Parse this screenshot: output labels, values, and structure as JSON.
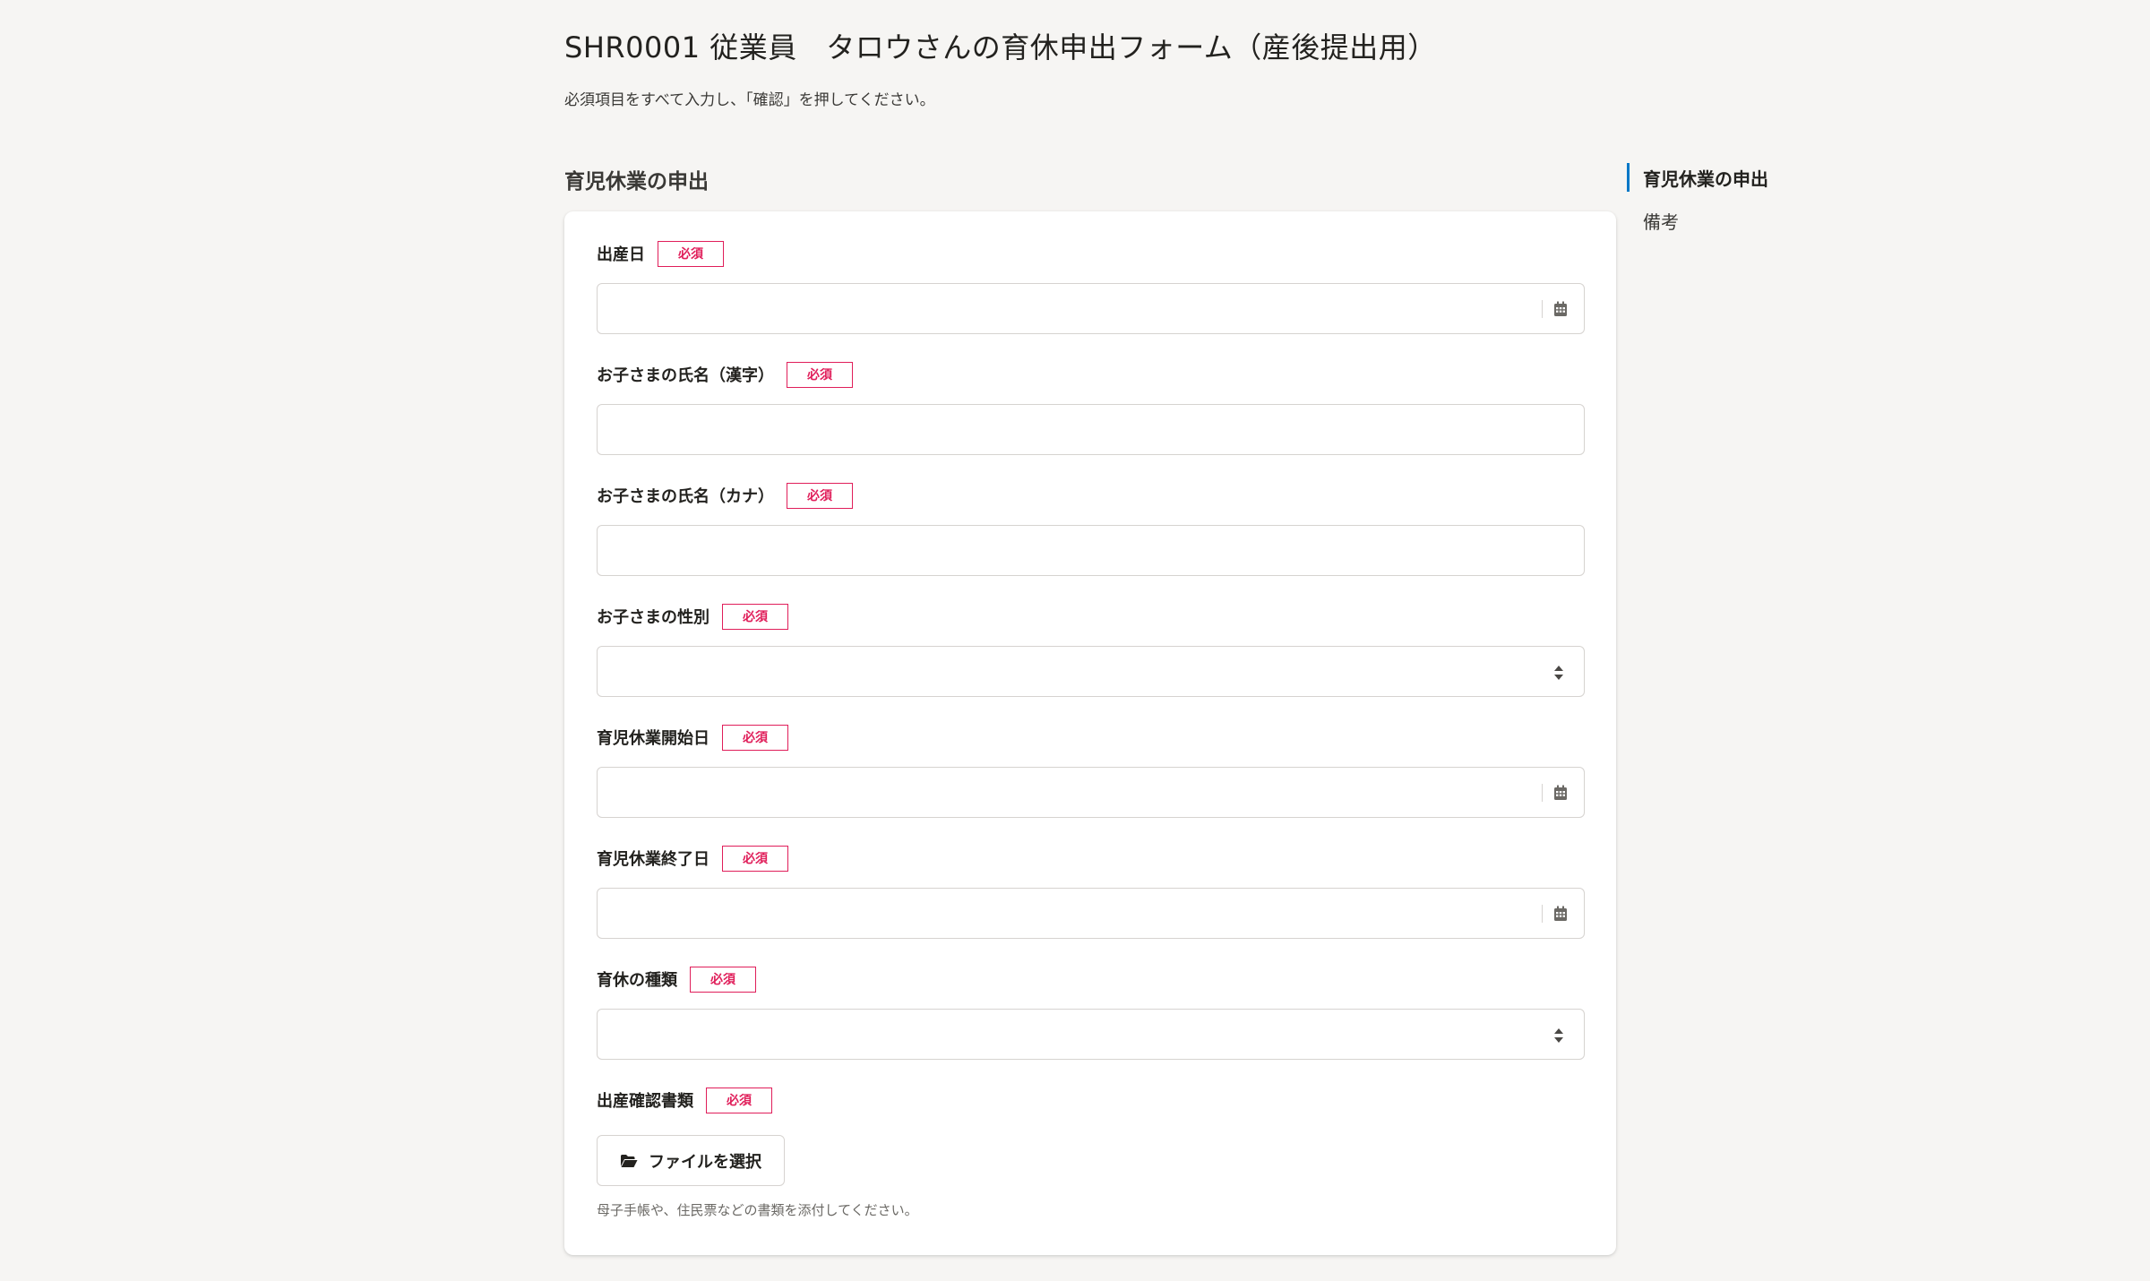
{
  "header": {
    "title": "SHR0001 従業員　タロウさんの育休申出フォーム（産後提出用）",
    "description": "必須項目をすべて入力し、「確認」を押してください。"
  },
  "section": {
    "heading": "育児休業の申出"
  },
  "required_label": "必須",
  "fields": [
    {
      "label": "出産日",
      "type": "date",
      "value": ""
    },
    {
      "label": "お子さまの氏名（漢字）",
      "type": "text",
      "value": ""
    },
    {
      "label": "お子さまの氏名（カナ）",
      "type": "text",
      "value": ""
    },
    {
      "label": "お子さまの性別",
      "type": "select",
      "value": ""
    },
    {
      "label": "育児休業開始日",
      "type": "date",
      "value": ""
    },
    {
      "label": "育児休業終了日",
      "type": "date",
      "value": ""
    },
    {
      "label": "育休の種類",
      "type": "select",
      "value": ""
    },
    {
      "label": "出産確認書類",
      "type": "file"
    }
  ],
  "file_upload": {
    "button_label": "ファイルを選択",
    "help_text": "母子手帳や、住民票などの書類を添付してください。"
  },
  "toc": {
    "items": [
      {
        "label": "育児休業の申出",
        "active": true
      },
      {
        "label": "備考",
        "active": false
      }
    ]
  },
  "colors": {
    "background": "#f6f5f3",
    "required": "#e01e5a",
    "toc_active_indicator": "#0077c7"
  }
}
